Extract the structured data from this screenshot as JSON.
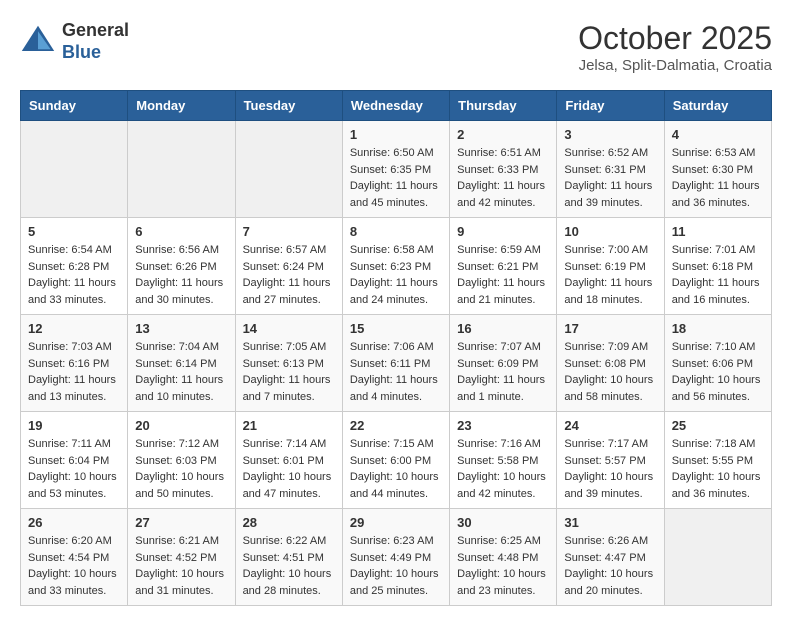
{
  "logo": {
    "general": "General",
    "blue": "Blue"
  },
  "title": "October 2025",
  "location": "Jelsa, Split-Dalmatia, Croatia",
  "days_of_week": [
    "Sunday",
    "Monday",
    "Tuesday",
    "Wednesday",
    "Thursday",
    "Friday",
    "Saturday"
  ],
  "weeks": [
    [
      {
        "day": "",
        "info": ""
      },
      {
        "day": "",
        "info": ""
      },
      {
        "day": "",
        "info": ""
      },
      {
        "day": "1",
        "info": "Sunrise: 6:50 AM\nSunset: 6:35 PM\nDaylight: 11 hours\nand 45 minutes."
      },
      {
        "day": "2",
        "info": "Sunrise: 6:51 AM\nSunset: 6:33 PM\nDaylight: 11 hours\nand 42 minutes."
      },
      {
        "day": "3",
        "info": "Sunrise: 6:52 AM\nSunset: 6:31 PM\nDaylight: 11 hours\nand 39 minutes."
      },
      {
        "day": "4",
        "info": "Sunrise: 6:53 AM\nSunset: 6:30 PM\nDaylight: 11 hours\nand 36 minutes."
      }
    ],
    [
      {
        "day": "5",
        "info": "Sunrise: 6:54 AM\nSunset: 6:28 PM\nDaylight: 11 hours\nand 33 minutes."
      },
      {
        "day": "6",
        "info": "Sunrise: 6:56 AM\nSunset: 6:26 PM\nDaylight: 11 hours\nand 30 minutes."
      },
      {
        "day": "7",
        "info": "Sunrise: 6:57 AM\nSunset: 6:24 PM\nDaylight: 11 hours\nand 27 minutes."
      },
      {
        "day": "8",
        "info": "Sunrise: 6:58 AM\nSunset: 6:23 PM\nDaylight: 11 hours\nand 24 minutes."
      },
      {
        "day": "9",
        "info": "Sunrise: 6:59 AM\nSunset: 6:21 PM\nDaylight: 11 hours\nand 21 minutes."
      },
      {
        "day": "10",
        "info": "Sunrise: 7:00 AM\nSunset: 6:19 PM\nDaylight: 11 hours\nand 18 minutes."
      },
      {
        "day": "11",
        "info": "Sunrise: 7:01 AM\nSunset: 6:18 PM\nDaylight: 11 hours\nand 16 minutes."
      }
    ],
    [
      {
        "day": "12",
        "info": "Sunrise: 7:03 AM\nSunset: 6:16 PM\nDaylight: 11 hours\nand 13 minutes."
      },
      {
        "day": "13",
        "info": "Sunrise: 7:04 AM\nSunset: 6:14 PM\nDaylight: 11 hours\nand 10 minutes."
      },
      {
        "day": "14",
        "info": "Sunrise: 7:05 AM\nSunset: 6:13 PM\nDaylight: 11 hours\nand 7 minutes."
      },
      {
        "day": "15",
        "info": "Sunrise: 7:06 AM\nSunset: 6:11 PM\nDaylight: 11 hours\nand 4 minutes."
      },
      {
        "day": "16",
        "info": "Sunrise: 7:07 AM\nSunset: 6:09 PM\nDaylight: 11 hours\nand 1 minute."
      },
      {
        "day": "17",
        "info": "Sunrise: 7:09 AM\nSunset: 6:08 PM\nDaylight: 10 hours\nand 58 minutes."
      },
      {
        "day": "18",
        "info": "Sunrise: 7:10 AM\nSunset: 6:06 PM\nDaylight: 10 hours\nand 56 minutes."
      }
    ],
    [
      {
        "day": "19",
        "info": "Sunrise: 7:11 AM\nSunset: 6:04 PM\nDaylight: 10 hours\nand 53 minutes."
      },
      {
        "day": "20",
        "info": "Sunrise: 7:12 AM\nSunset: 6:03 PM\nDaylight: 10 hours\nand 50 minutes."
      },
      {
        "day": "21",
        "info": "Sunrise: 7:14 AM\nSunset: 6:01 PM\nDaylight: 10 hours\nand 47 minutes."
      },
      {
        "day": "22",
        "info": "Sunrise: 7:15 AM\nSunset: 6:00 PM\nDaylight: 10 hours\nand 44 minutes."
      },
      {
        "day": "23",
        "info": "Sunrise: 7:16 AM\nSunset: 5:58 PM\nDaylight: 10 hours\nand 42 minutes."
      },
      {
        "day": "24",
        "info": "Sunrise: 7:17 AM\nSunset: 5:57 PM\nDaylight: 10 hours\nand 39 minutes."
      },
      {
        "day": "25",
        "info": "Sunrise: 7:18 AM\nSunset: 5:55 PM\nDaylight: 10 hours\nand 36 minutes."
      }
    ],
    [
      {
        "day": "26",
        "info": "Sunrise: 6:20 AM\nSunset: 4:54 PM\nDaylight: 10 hours\nand 33 minutes."
      },
      {
        "day": "27",
        "info": "Sunrise: 6:21 AM\nSunset: 4:52 PM\nDaylight: 10 hours\nand 31 minutes."
      },
      {
        "day": "28",
        "info": "Sunrise: 6:22 AM\nSunset: 4:51 PM\nDaylight: 10 hours\nand 28 minutes."
      },
      {
        "day": "29",
        "info": "Sunrise: 6:23 AM\nSunset: 4:49 PM\nDaylight: 10 hours\nand 25 minutes."
      },
      {
        "day": "30",
        "info": "Sunrise: 6:25 AM\nSunset: 4:48 PM\nDaylight: 10 hours\nand 23 minutes."
      },
      {
        "day": "31",
        "info": "Sunrise: 6:26 AM\nSunset: 4:47 PM\nDaylight: 10 hours\nand 20 minutes."
      },
      {
        "day": "",
        "info": ""
      }
    ]
  ]
}
